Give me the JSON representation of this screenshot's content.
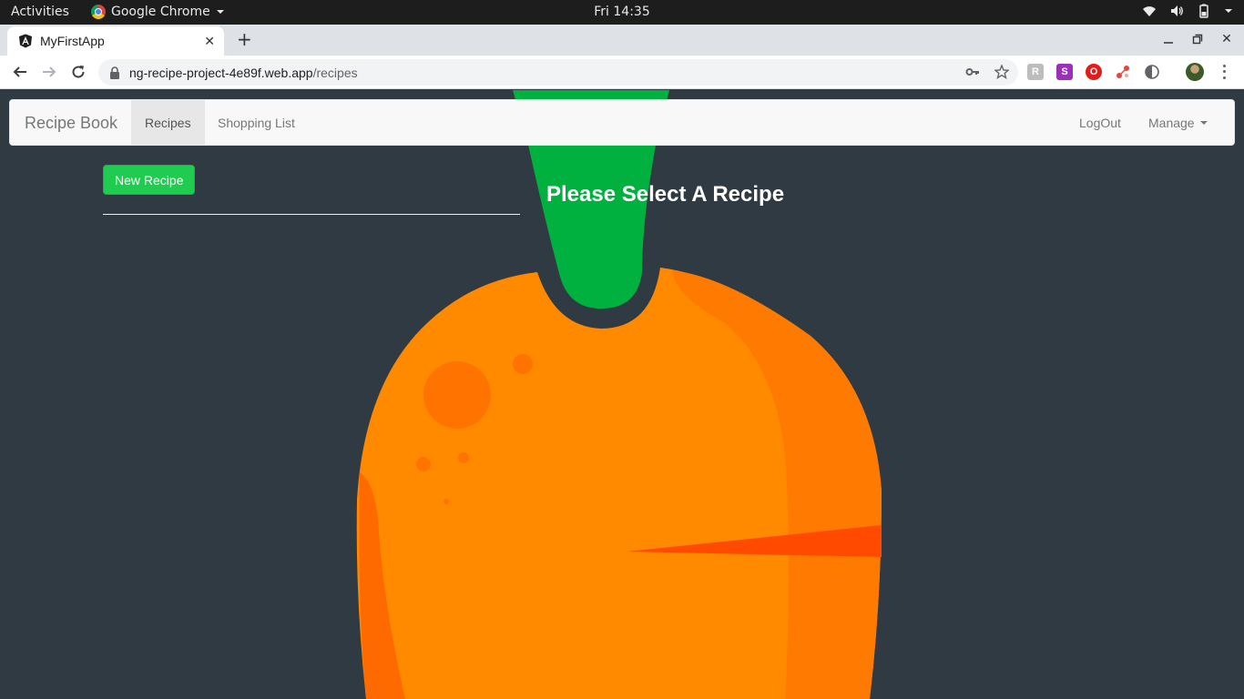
{
  "os_bar": {
    "activities": "Activities",
    "app_name": "Google Chrome",
    "clock": "Fri 14:35"
  },
  "browser": {
    "tab_title": "MyFirstApp",
    "url_host": "ng-recipe-project-4e89f.web.app",
    "url_path": "/recipes",
    "extensions": [
      "R",
      "S",
      "O",
      "",
      ""
    ]
  },
  "navbar": {
    "brand": "Recipe Book",
    "items": [
      {
        "label": "Recipes",
        "active": true
      },
      {
        "label": "Shopping List",
        "active": false
      }
    ],
    "logout": "LogOut",
    "manage": "Manage"
  },
  "recipes": {
    "new_button": "New Recipe",
    "placeholder": "Please Select A Recipe"
  },
  "colors": {
    "page_bg": "#303a43",
    "accent_green": "#1fcc4f",
    "carrot_orange": "#ff8a00",
    "carrot_leaf": "#00b140"
  }
}
